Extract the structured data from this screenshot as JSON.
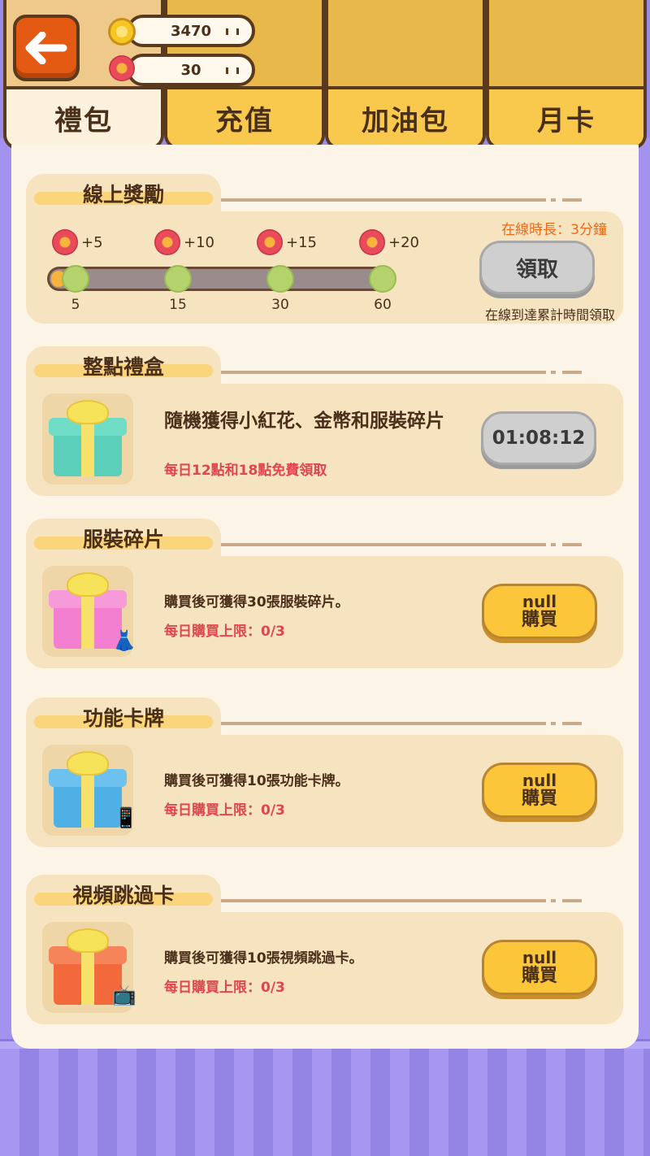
{
  "header": {
    "coins": "3470",
    "flowers": "30",
    "tabs": [
      {
        "label": "禮包",
        "active": true
      },
      {
        "label": "充值",
        "active": false
      },
      {
        "label": "加油包",
        "active": false
      },
      {
        "label": "月卡",
        "active": false
      }
    ]
  },
  "online_reward": {
    "title": "線上獎勵",
    "online_time": "在線時長：3分鐘",
    "rewards": [
      "+5",
      "+10",
      "+15",
      "+20"
    ],
    "ticks": [
      "5",
      "15",
      "30",
      "60"
    ],
    "claim_label": "領取",
    "hint": "在線到達累計時間領取"
  },
  "hourly_box": {
    "title": "整點禮盒",
    "desc": "隨機獲得小紅花、金幣和服裝碎片",
    "note": "每日12點和18點免費領取",
    "timer": "01:08:12"
  },
  "packs": [
    {
      "title": "服裝碎片",
      "desc": "購買後可獲得30張服裝碎片。",
      "limit": "每日購買上限：0/3",
      "price": "null",
      "buy": "購買",
      "color": "#f27fcf"
    },
    {
      "title": "功能卡牌",
      "desc": "購買後可獲得10張功能卡牌。",
      "limit": "每日購買上限：0/3",
      "price": "null",
      "buy": "購買",
      "color": "#4fb0e6"
    },
    {
      "title": "視頻跳過卡",
      "desc": "購買後可獲得10張視頻跳過卡。",
      "limit": "每日購買上限：0/3",
      "price": "null",
      "buy": "購買",
      "color": "#f26a3c"
    }
  ],
  "colors": {
    "accent": "#f8c94c",
    "panel": "#fcf4e6",
    "back": "#e55a12",
    "limit_text": "#e0464e"
  }
}
